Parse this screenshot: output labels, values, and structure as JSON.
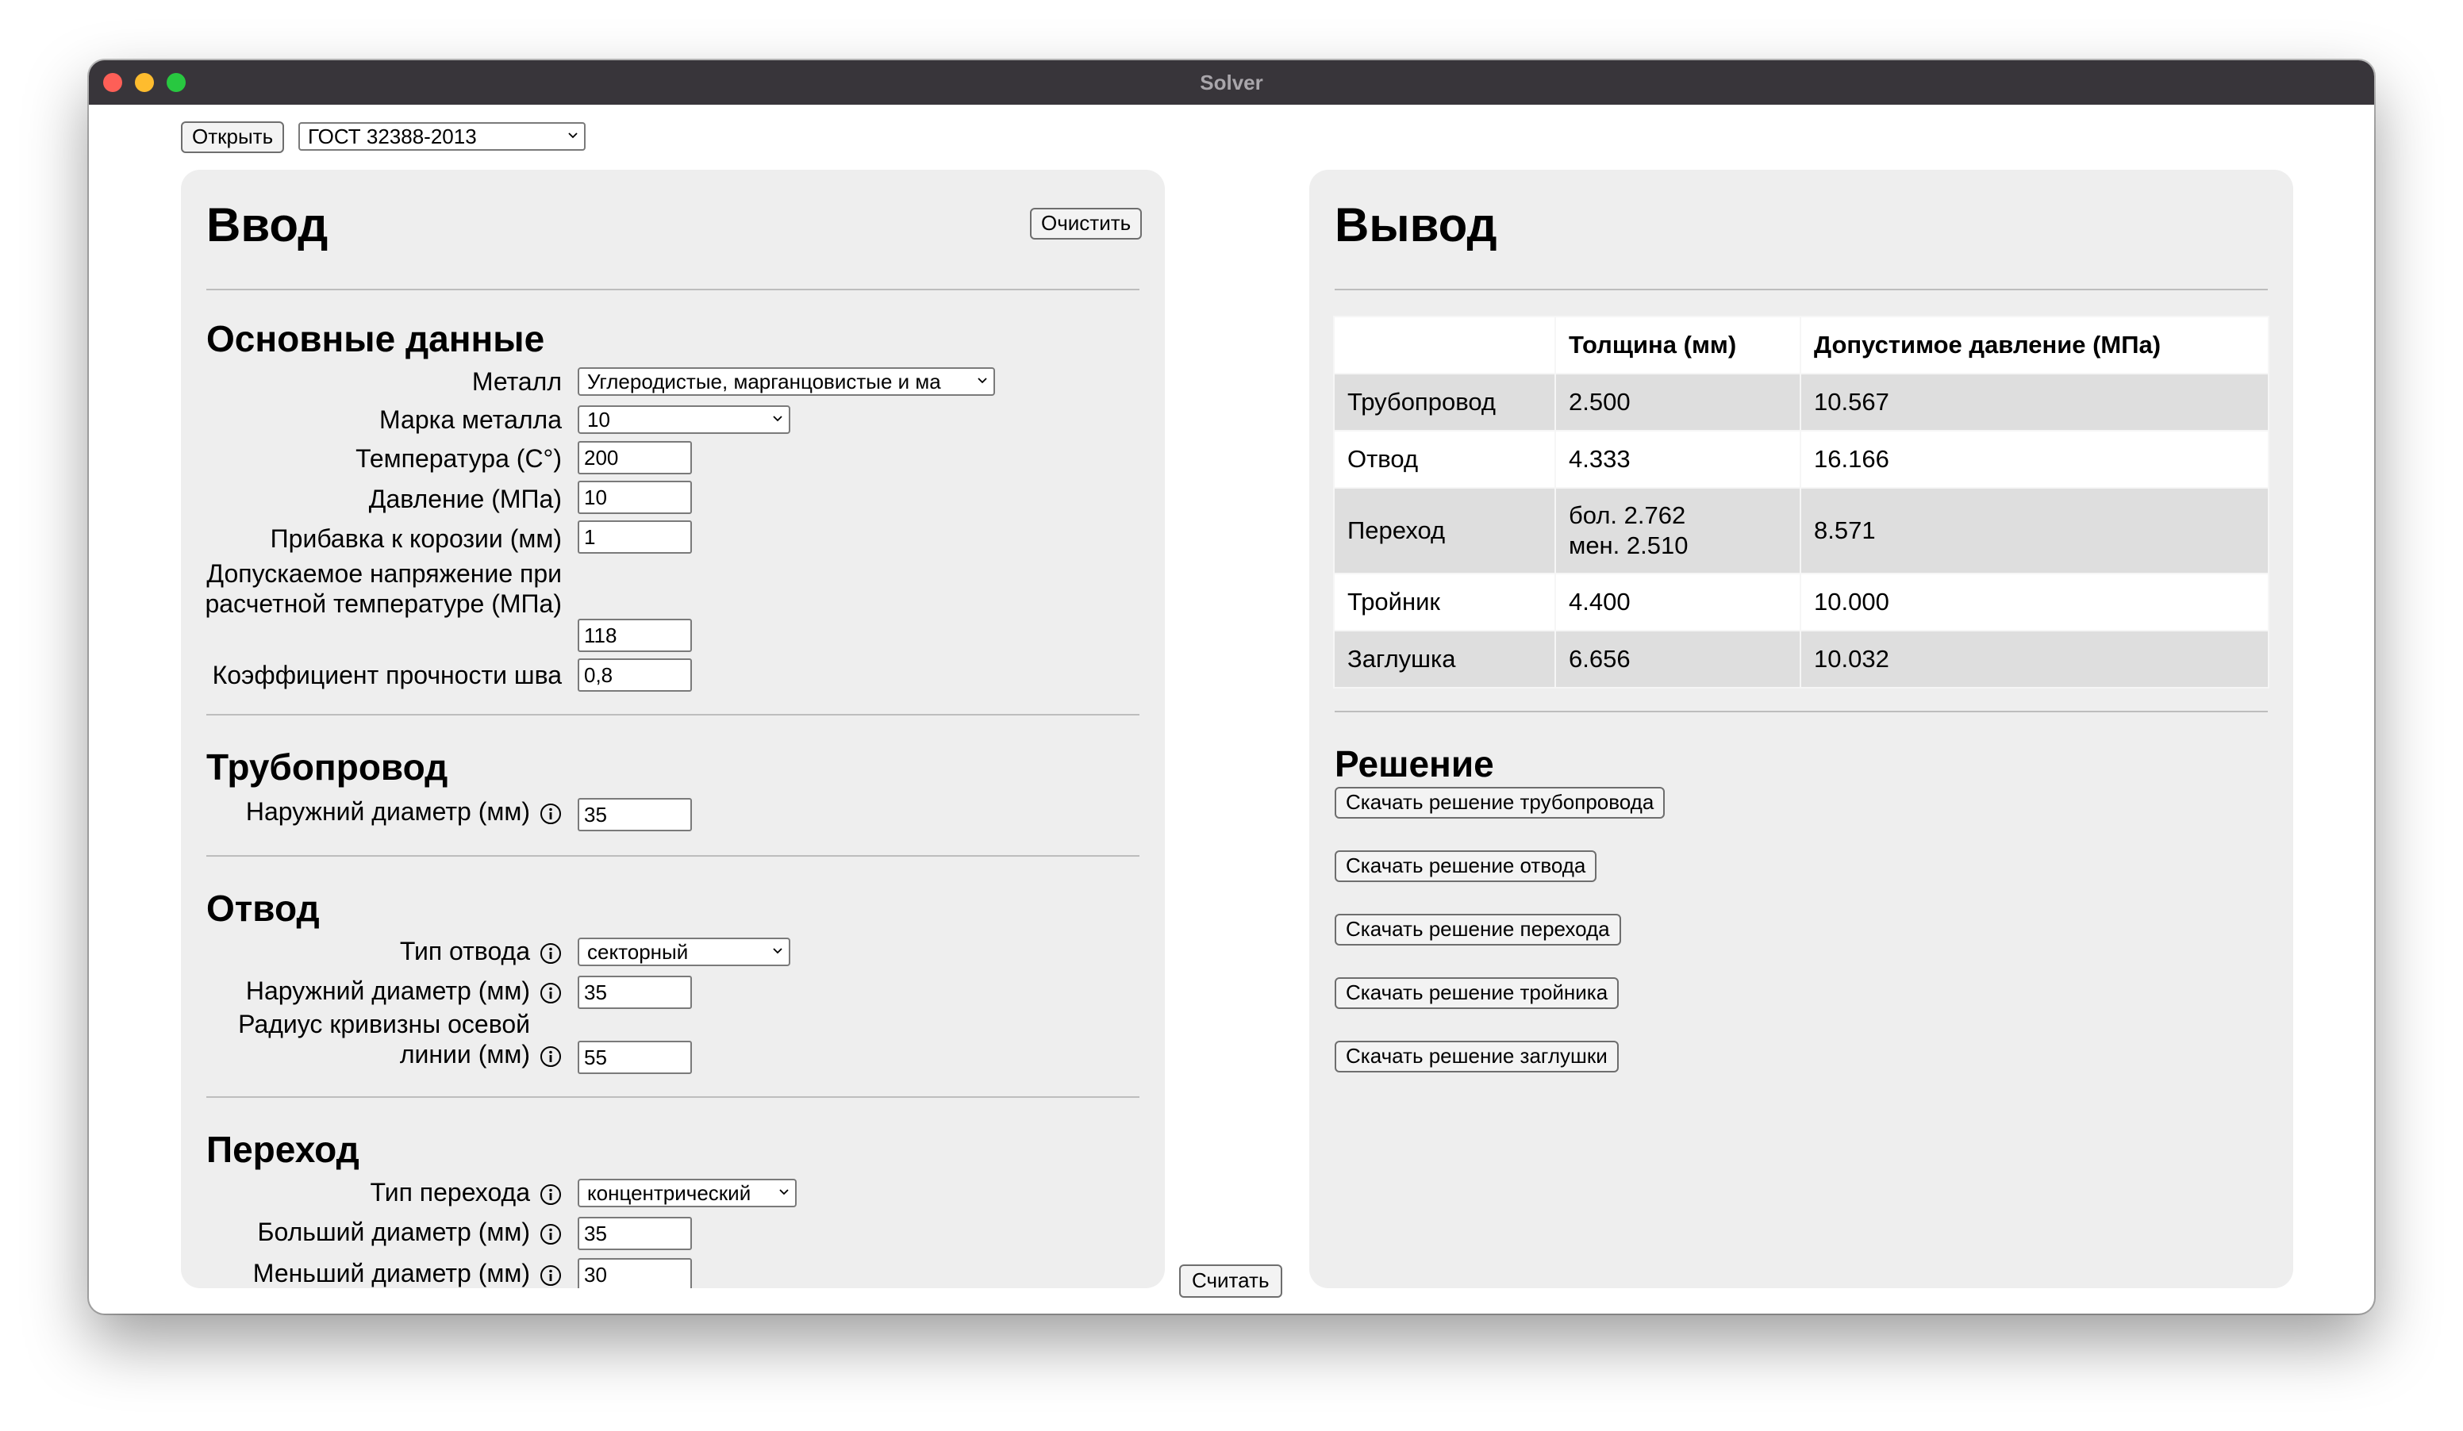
{
  "window": {
    "title": "Solver"
  },
  "toolbar": {
    "open_label": "Открыть",
    "standard_value": "ГОСТ 32388-2013"
  },
  "input_panel": {
    "title": "Ввод",
    "clear_label": "Очистить",
    "basic": {
      "title": "Основные данные",
      "metal_label": "Металл",
      "metal_value": "Углеродистые, марганцовистые и ма",
      "grade_label": "Марка металла",
      "grade_value": "10",
      "temperature_label": "Температура (С°)",
      "temperature_value": "200",
      "pressure_label": "Давление (МПа)",
      "pressure_value": "10",
      "corrosion_label": "Прибавка к корозии (мм)",
      "corrosion_value": "1",
      "stress_label": "Допускаемое напряжение при расчетной температуре (МПа)",
      "stress_value": "118",
      "weld_label": "Коэффициент прочности шва",
      "weld_value": "0,8"
    },
    "pipeline": {
      "title": "Трубопровод",
      "diameter_label": "Наружний диаметр (мм)",
      "diameter_value": "35"
    },
    "bend": {
      "title": "Отвод",
      "type_label": "Тип отвода",
      "type_value": "секторный",
      "diameter_label": "Наружний диаметр (мм)",
      "diameter_value": "35",
      "radius_label": "Радиус кривизны осевой линии (мм)",
      "radius_value": "55"
    },
    "reducer": {
      "title": "Переход",
      "type_label": "Тип перехода",
      "type_value": "концентрический",
      "large_label": "Больший диаметр (мм)",
      "large_value": "35",
      "small_label": "Меньший диаметр (мм)",
      "small_value": "30"
    }
  },
  "calculate_label": "Считать",
  "output_panel": {
    "title": "Вывод",
    "table": {
      "headers": [
        "",
        "Толщина (мм)",
        "Допустимое давление (МПа)"
      ],
      "rows": [
        {
          "name": "Трубопровод",
          "thickness": "2.500",
          "pressure": "10.567"
        },
        {
          "name": "Отвод",
          "thickness": "4.333",
          "pressure": "16.166"
        },
        {
          "name": "Переход",
          "thickness_big": "бол. 2.762",
          "thickness_small": "мен. 2.510",
          "pressure": "8.571"
        },
        {
          "name": "Тройник",
          "thickness": "4.400",
          "pressure": "10.000"
        },
        {
          "name": "Заглушка",
          "thickness": "6.656",
          "pressure": "10.032"
        }
      ]
    },
    "solution": {
      "title": "Решение",
      "download_pipeline": "Скачать решение трубопровода",
      "download_bend": "Скачать решение отвода",
      "download_reducer": "Скачать решение перехода",
      "download_tee": "Скачать решение тройника",
      "download_cap": "Скачать решение заглушки"
    }
  }
}
